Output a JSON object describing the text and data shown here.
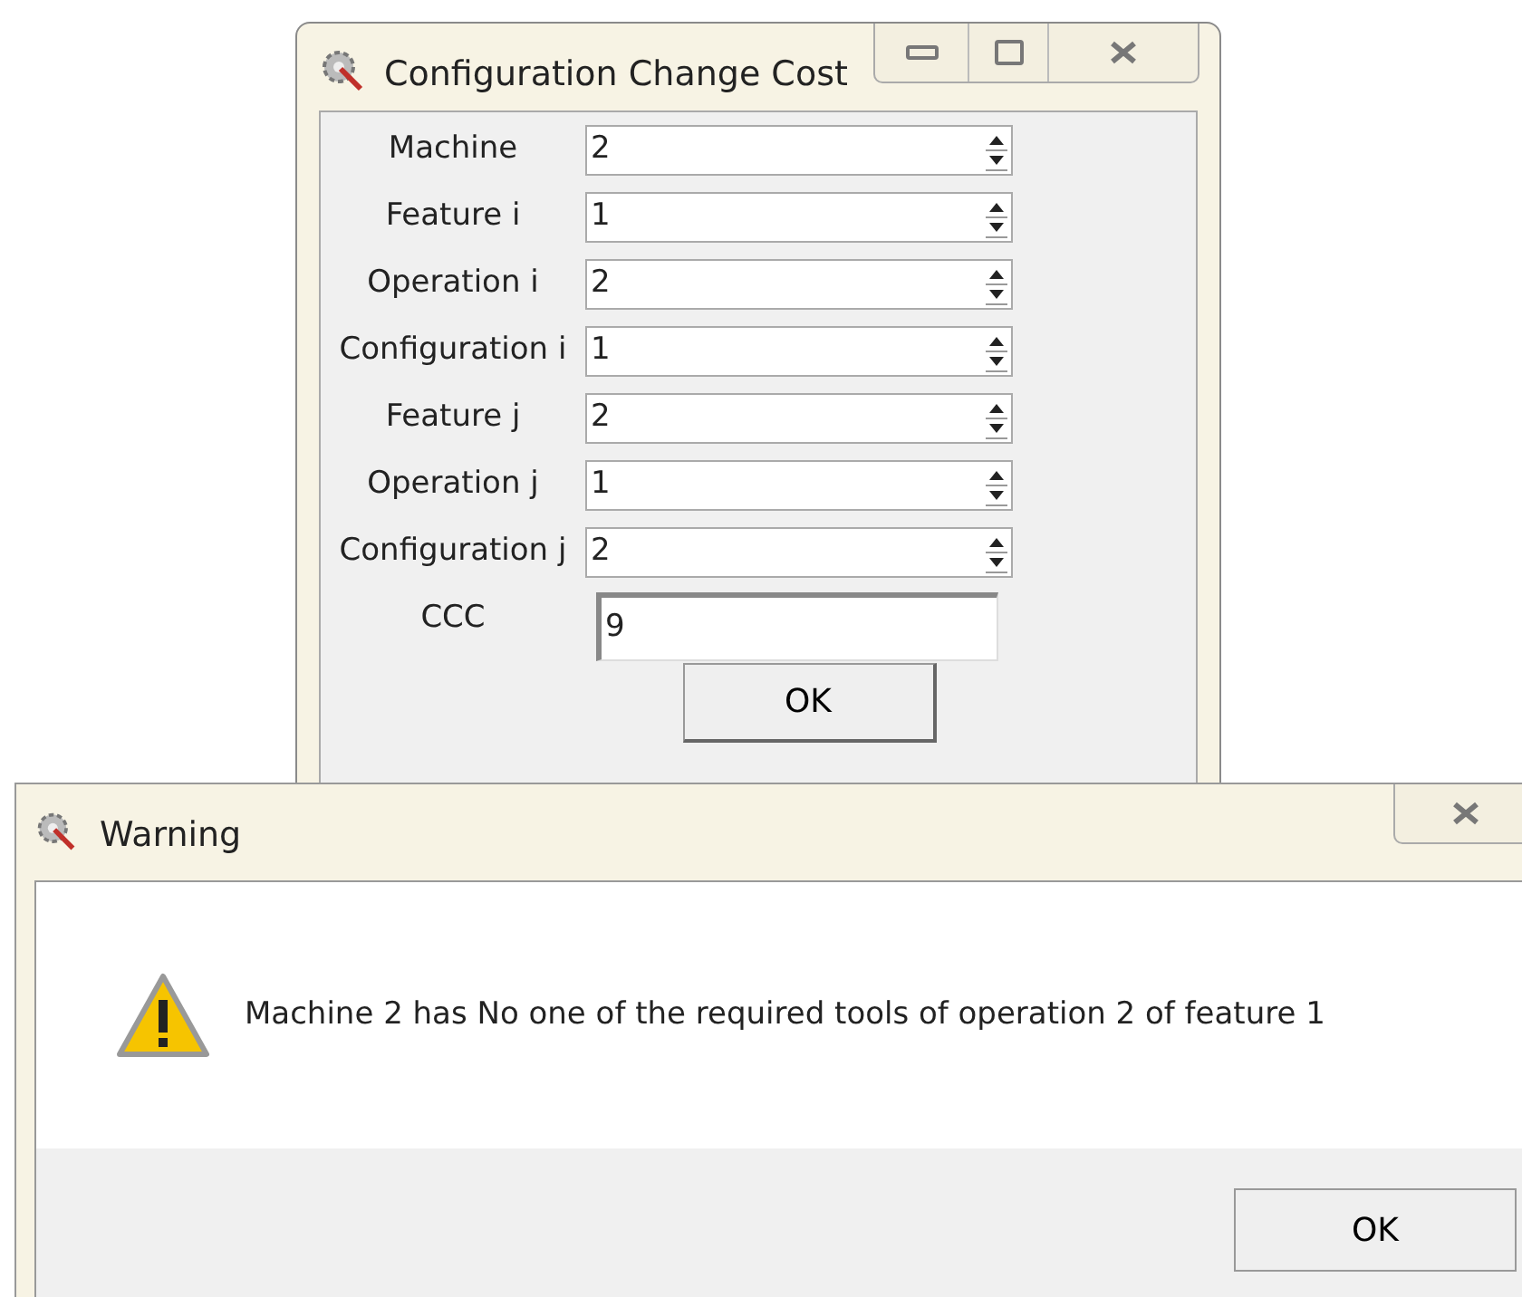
{
  "main_window": {
    "title": "Configuration Change Cost",
    "fields": [
      {
        "label": "Machine",
        "value": "2",
        "kind": "spinner"
      },
      {
        "label": "Feature i",
        "value": "1",
        "kind": "spinner"
      },
      {
        "label": "Operation i",
        "value": "2",
        "kind": "spinner"
      },
      {
        "label": "Configuration i",
        "value": "1",
        "kind": "spinner"
      },
      {
        "label": "Feature j",
        "value": "2",
        "kind": "spinner"
      },
      {
        "label": "Operation j",
        "value": "1",
        "kind": "spinner"
      },
      {
        "label": "Configuration j",
        "value": "2",
        "kind": "spinner"
      },
      {
        "label": "CCC",
        "value": "9",
        "kind": "text"
      }
    ],
    "button": "OK"
  },
  "warning_dialog": {
    "title": "Warning",
    "message": "Machine 2 has No one of the required tools of operation 2 of feature 1",
    "button": "OK"
  }
}
